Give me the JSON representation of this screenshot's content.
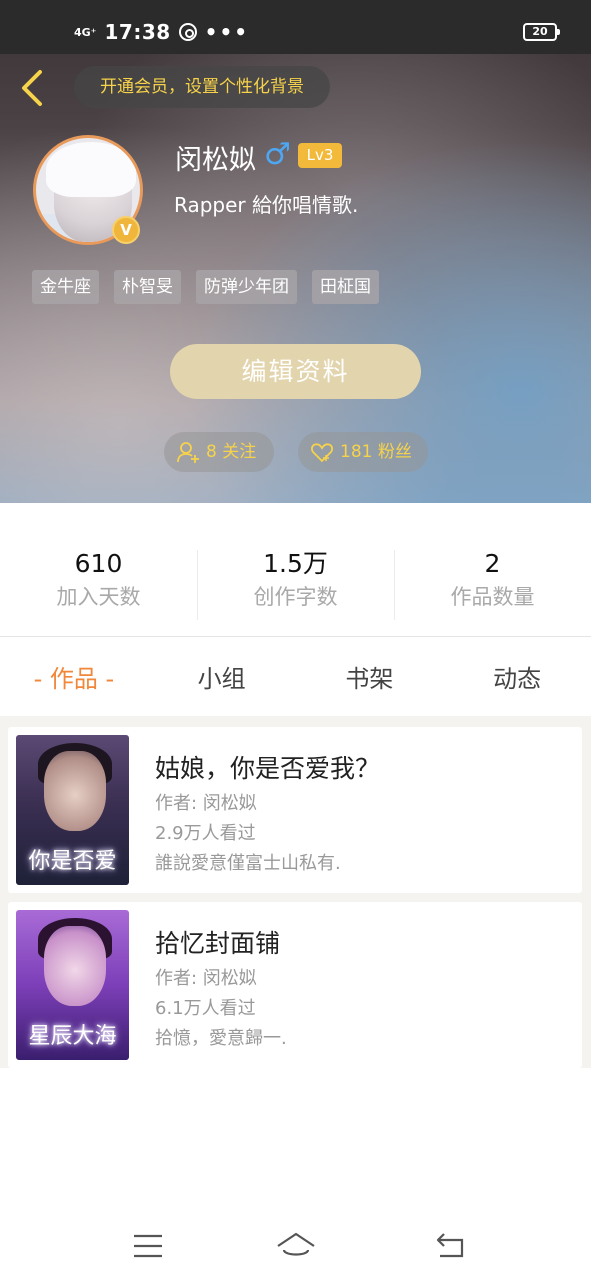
{
  "status_bar": {
    "signal": "4G⁺",
    "time": "17:38",
    "dots": "•••",
    "battery": "20"
  },
  "header": {
    "vip_banner": "开通会员，设置个性化背景"
  },
  "profile": {
    "username": "闵松姒",
    "gender_symbol": "♂",
    "level": "Lv3",
    "verified_badge": "V",
    "bio": "Rapper 給你唱情歌.",
    "tags": [
      "金牛座",
      "朴智旻",
      "防弹少年团",
      "田柾国"
    ],
    "edit_button": "编辑资料",
    "following_label": "8 关注",
    "fans_label": "181 粉丝"
  },
  "stats": [
    {
      "value": "610",
      "label": "加入天数"
    },
    {
      "value": "1.5万",
      "label": "创作字数"
    },
    {
      "value": "2",
      "label": "作品数量"
    }
  ],
  "tabs": [
    "- 作品 -",
    "小组",
    "书架",
    "动态"
  ],
  "active_tab_index": 0,
  "books": [
    {
      "title": "姑娘，你是否爱我？",
      "author": "作者: 闵松姒",
      "views": "2.9万人看过",
      "description": "誰說愛意僅富士山私有.",
      "cover_text": "你是否爱"
    },
    {
      "title": "拾忆封面铺",
      "author": "作者: 闵松姒",
      "views": "6.1万人看过",
      "description": "拾憶，愛意歸一.",
      "cover_text": "星辰大海"
    }
  ],
  "colors": {
    "accent_orange": "#f0873a",
    "gold_text": "#f6d34a",
    "level_badge": "#f2b93a",
    "edit_button_bg": "#e2d4ac",
    "gender_blue": "#4ea7f2"
  },
  "icons": {
    "back": "chevron-left-icon",
    "following": "add-user-icon",
    "fans": "heart-icon",
    "nav": [
      "menu-icon",
      "home-icon",
      "back-arrow-icon"
    ]
  }
}
